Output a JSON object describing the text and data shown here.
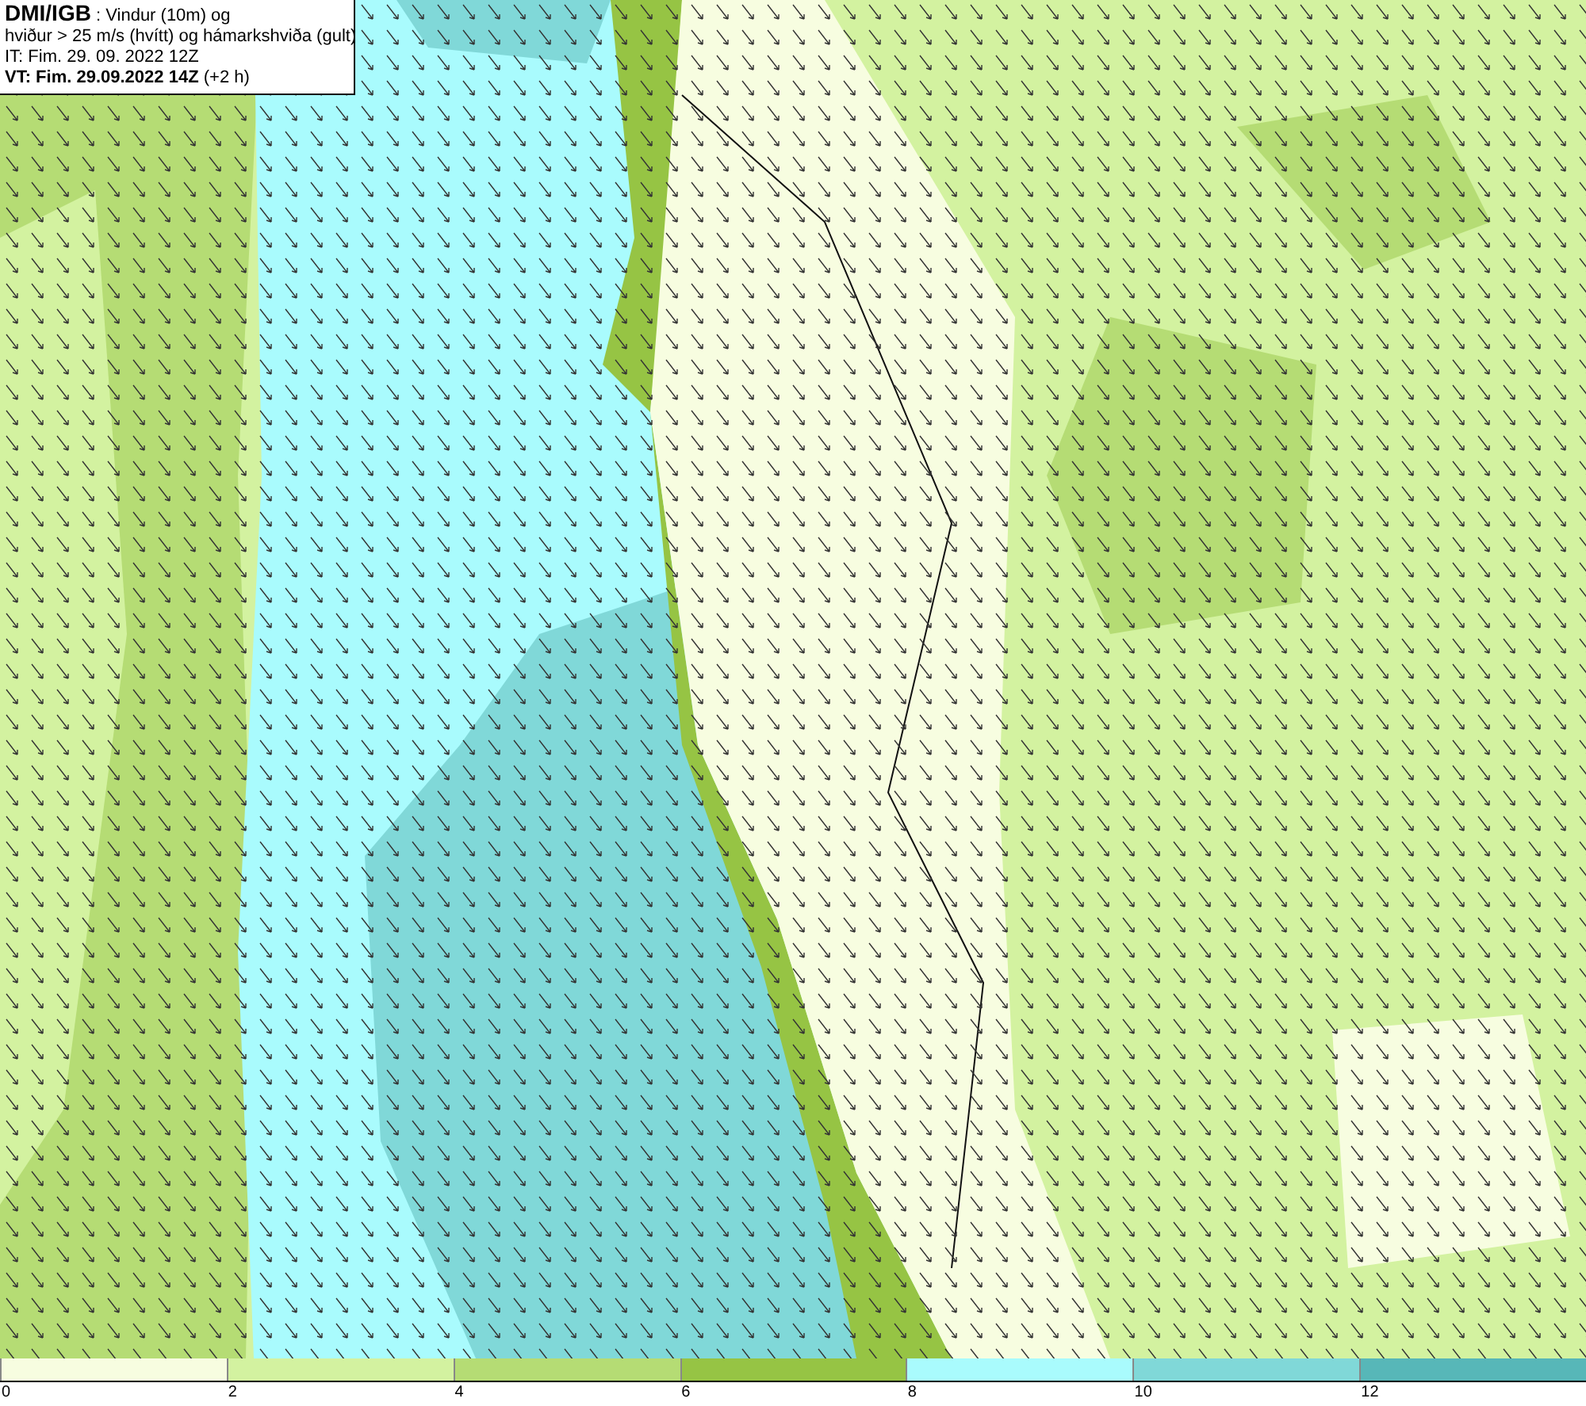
{
  "title_box": {
    "lines": [
      "**DMI/IGB** : Vindur (10m) og",
      "hviður > 25 m/s (hvítt) og hámarkshviða (gult)",
      "IT: Fim. 29. 09. 2022 12Z",
      "**VT: Fim. 29.09.2022 14Z** (+2 h)"
    ]
  },
  "legend": {
    "segments": [
      {
        "color": "#f7fde0"
      },
      {
        "color": "#d3f2a0"
      },
      {
        "color": "#b5dc74"
      },
      {
        "color": "#96c444"
      },
      {
        "color": "#a9fbfd"
      },
      {
        "color": "#80d8d8"
      },
      {
        "color": "#57b7b8"
      }
    ],
    "labels": [
      "0",
      "2",
      "4",
      "6",
      "8",
      "10",
      "12"
    ]
  }
}
